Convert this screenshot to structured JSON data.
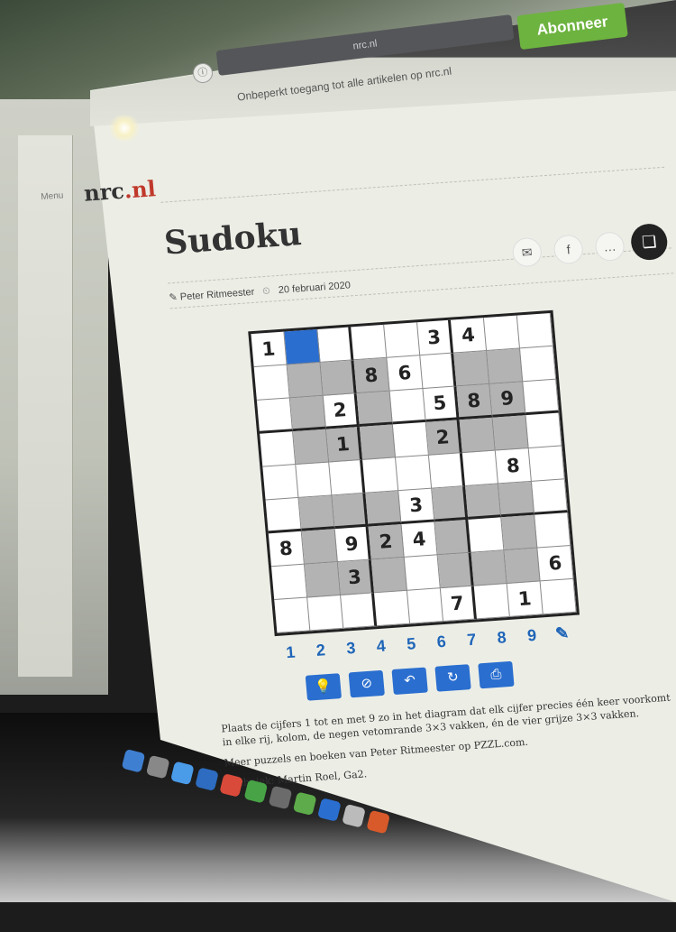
{
  "browser": {
    "url": "nrc.nl",
    "subscribe_label": "Abonneer",
    "promo_text": "Onbeperkt toegang tot alle artikelen op nrc.nl"
  },
  "site": {
    "logo_text": "nrc",
    "logo_suffix": ".nl",
    "menu_label": "Menu"
  },
  "article": {
    "title": "Sudoku",
    "author": "Peter Ritmeester",
    "date": "20 februari 2020"
  },
  "share": {
    "mail_icon": "mail-icon",
    "facebook_icon": "facebook-icon",
    "more_icon": "more-icon",
    "bookmark_icon": "bookmark-icon"
  },
  "sudoku": {
    "selected_cell": [
      0,
      1
    ],
    "grid": [
      [
        "1",
        "",
        "",
        "",
        "",
        "3",
        "4",
        "",
        ""
      ],
      [
        "",
        "",
        "",
        "8",
        "6",
        "",
        "",
        "",
        ""
      ],
      [
        "",
        "",
        "2",
        "",
        "",
        "5",
        "8",
        "9",
        ""
      ],
      [
        "",
        "",
        "1",
        "",
        "",
        "2",
        "",
        "",
        ""
      ],
      [
        "",
        "",
        "",
        "",
        "",
        "",
        "",
        "8",
        ""
      ],
      [
        "",
        "",
        "",
        "",
        "3",
        "",
        "",
        "",
        ""
      ],
      [
        "8",
        "",
        "9",
        "2",
        "4",
        "",
        "",
        "",
        ""
      ],
      [
        "",
        "",
        "3",
        "",
        "",
        "",
        "",
        "",
        "6"
      ],
      [
        "",
        "",
        "",
        "",
        "",
        "7",
        "",
        "1",
        ""
      ]
    ],
    "grey_cells": [
      [
        1,
        1
      ],
      [
        1,
        2
      ],
      [
        1,
        3
      ],
      [
        1,
        6
      ],
      [
        1,
        7
      ],
      [
        2,
        1
      ],
      [
        2,
        3
      ],
      [
        2,
        6
      ],
      [
        2,
        7
      ],
      [
        3,
        1
      ],
      [
        3,
        2
      ],
      [
        3,
        3
      ],
      [
        3,
        5
      ],
      [
        3,
        6
      ],
      [
        3,
        7
      ],
      [
        5,
        1
      ],
      [
        5,
        2
      ],
      [
        5,
        3
      ],
      [
        5,
        5
      ],
      [
        5,
        6
      ],
      [
        5,
        7
      ],
      [
        6,
        1
      ],
      [
        6,
        3
      ],
      [
        6,
        5
      ],
      [
        6,
        7
      ],
      [
        7,
        1
      ],
      [
        7,
        2
      ],
      [
        7,
        3
      ],
      [
        7,
        5
      ],
      [
        7,
        6
      ],
      [
        7,
        7
      ]
    ]
  },
  "numpad": [
    "1",
    "2",
    "3",
    "4",
    "5",
    "6",
    "7",
    "8",
    "9"
  ],
  "tools": [
    {
      "name": "hint-button",
      "icon": "lightbulb-icon",
      "glyph": "💡"
    },
    {
      "name": "hide-button",
      "icon": "eye-slash-icon",
      "glyph": "⊘"
    },
    {
      "name": "undo-button",
      "icon": "undo-icon",
      "glyph": "↶"
    },
    {
      "name": "reset-button",
      "icon": "reset-icon",
      "glyph": "↻"
    },
    {
      "name": "print-button",
      "icon": "print-icon",
      "glyph": "⎙"
    }
  ],
  "instructions": {
    "p1": "Plaats de cijfers 1 tot en met 9 zo in het diagram dat elk cijfer precies één keer voorkomt in elke rij, kolom, de negen vetomrande 3×3 vakken, én de vier grijze 3×3 vakken.",
    "p2": "Meer puzzels en boeken van Peter Ritmeester op PZZL.com.",
    "p3": "Techniek: Martin Roel, Ga2."
  },
  "colors": {
    "accent_blue": "#2a6ecf",
    "subscribe_green": "#6db33f",
    "grey_cell": "#b3b3b3"
  }
}
